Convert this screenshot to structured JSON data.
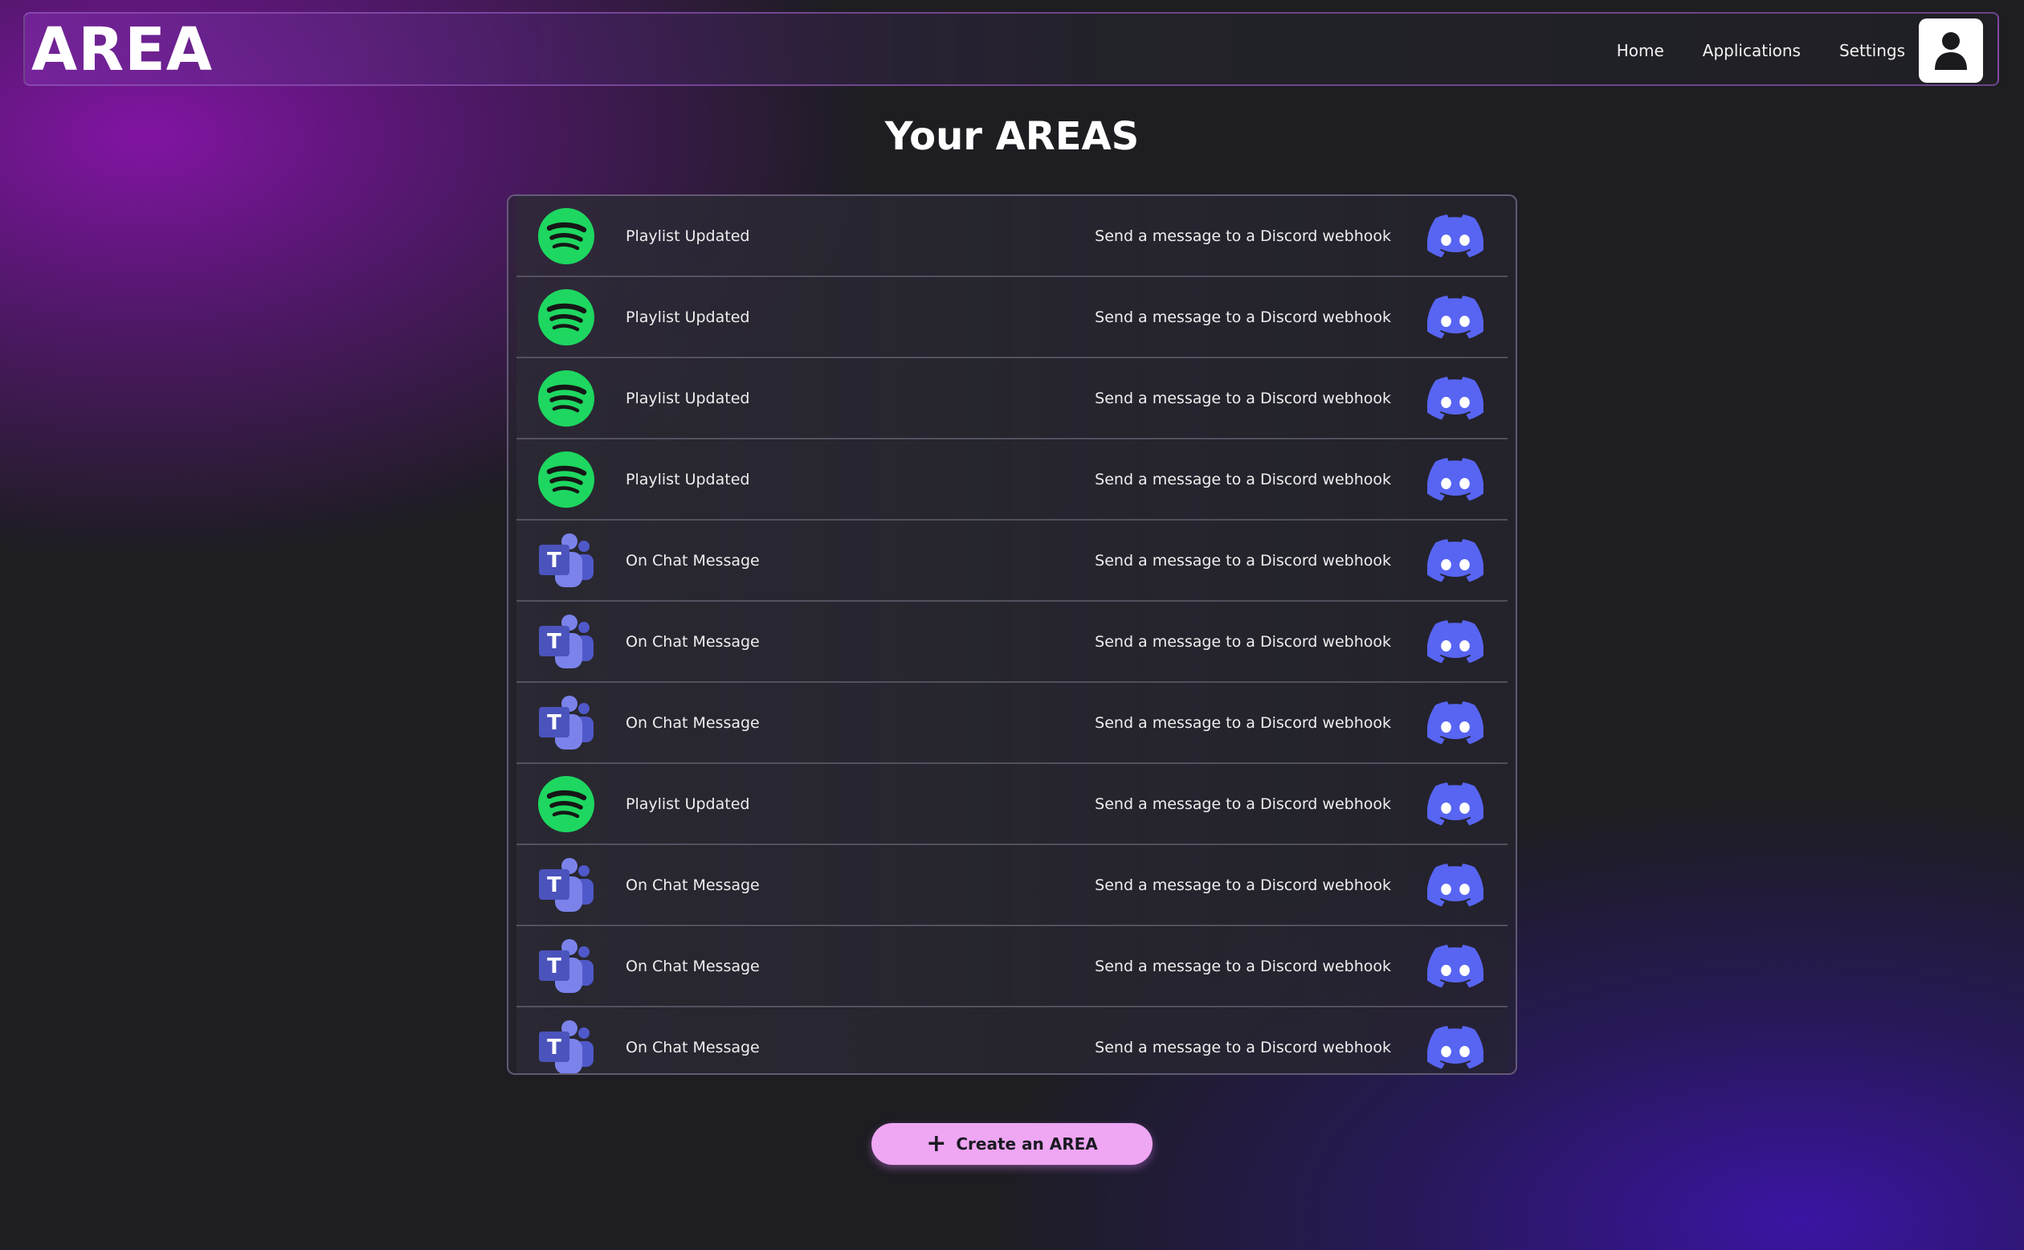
{
  "header": {
    "brand": "AREA",
    "nav": [
      {
        "label": "Home"
      },
      {
        "label": "Applications"
      },
      {
        "label": "Settings"
      }
    ],
    "profile_icon": "user-icon"
  },
  "main": {
    "title": "Your AREAS",
    "areas": [
      {
        "service_icon": "spotify-icon",
        "trigger": "Playlist Updated",
        "reaction": "Send a message to a Discord webhook",
        "reaction_icon": "discord-icon"
      },
      {
        "service_icon": "spotify-icon",
        "trigger": "Playlist Updated",
        "reaction": "Send a message to a Discord webhook",
        "reaction_icon": "discord-icon"
      },
      {
        "service_icon": "spotify-icon",
        "trigger": "Playlist Updated",
        "reaction": "Send a message to a Discord webhook",
        "reaction_icon": "discord-icon"
      },
      {
        "service_icon": "spotify-icon",
        "trigger": "Playlist Updated",
        "reaction": "Send a message to a Discord webhook",
        "reaction_icon": "discord-icon"
      },
      {
        "service_icon": "teams-icon",
        "trigger": "On Chat Message",
        "reaction": "Send a message to a Discord webhook",
        "reaction_icon": "discord-icon"
      },
      {
        "service_icon": "teams-icon",
        "trigger": "On Chat Message",
        "reaction": "Send a message to a Discord webhook",
        "reaction_icon": "discord-icon"
      },
      {
        "service_icon": "teams-icon",
        "trigger": "On Chat Message",
        "reaction": "Send a message to a Discord webhook",
        "reaction_icon": "discord-icon"
      },
      {
        "service_icon": "spotify-icon",
        "trigger": "Playlist Updated",
        "reaction": "Send a message to a Discord webhook",
        "reaction_icon": "discord-icon"
      },
      {
        "service_icon": "teams-icon",
        "trigger": "On Chat Message",
        "reaction": "Send a message to a Discord webhook",
        "reaction_icon": "discord-icon"
      },
      {
        "service_icon": "teams-icon",
        "trigger": "On Chat Message",
        "reaction": "Send a message to a Discord webhook",
        "reaction_icon": "discord-icon"
      },
      {
        "service_icon": "teams-icon",
        "trigger": "On Chat Message",
        "reaction": "Send a message to a Discord webhook",
        "reaction_icon": "discord-icon"
      }
    ],
    "create_button": {
      "label": "Create an AREA",
      "icon": "plus-icon"
    }
  },
  "colors": {
    "accent_purple": "#8714aa",
    "accent_indigo": "#3c14aa",
    "button_pink": "#efa6f3",
    "spotify_green": "#1ed760",
    "discord_blurple": "#5865f2",
    "teams_purple": "#5059c9"
  }
}
